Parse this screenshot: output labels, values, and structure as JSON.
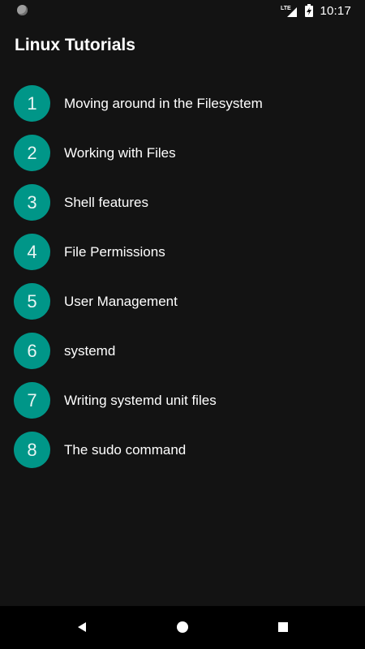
{
  "status_bar": {
    "time": "10:17",
    "network": "LTE",
    "icons": [
      "notification-dot-icon",
      "lte-signal-icon",
      "battery-charging-icon"
    ]
  },
  "app": {
    "title": "Linux Tutorials"
  },
  "tutorials": [
    {
      "number": "1",
      "label": "Moving around in the Filesystem"
    },
    {
      "number": "2",
      "label": "Working with Files"
    },
    {
      "number": "3",
      "label": "Shell features"
    },
    {
      "number": "4",
      "label": "File Permissions"
    },
    {
      "number": "5",
      "label": "User Management"
    },
    {
      "number": "6",
      "label": "systemd"
    },
    {
      "number": "7",
      "label": "Writing systemd unit files"
    },
    {
      "number": "8",
      "label": "The sudo command"
    }
  ],
  "nav_bar": {
    "icons": [
      "back-icon",
      "home-icon",
      "recents-icon"
    ]
  },
  "colors": {
    "background": "#131313",
    "accent": "#009688",
    "text": "#ffffff"
  }
}
